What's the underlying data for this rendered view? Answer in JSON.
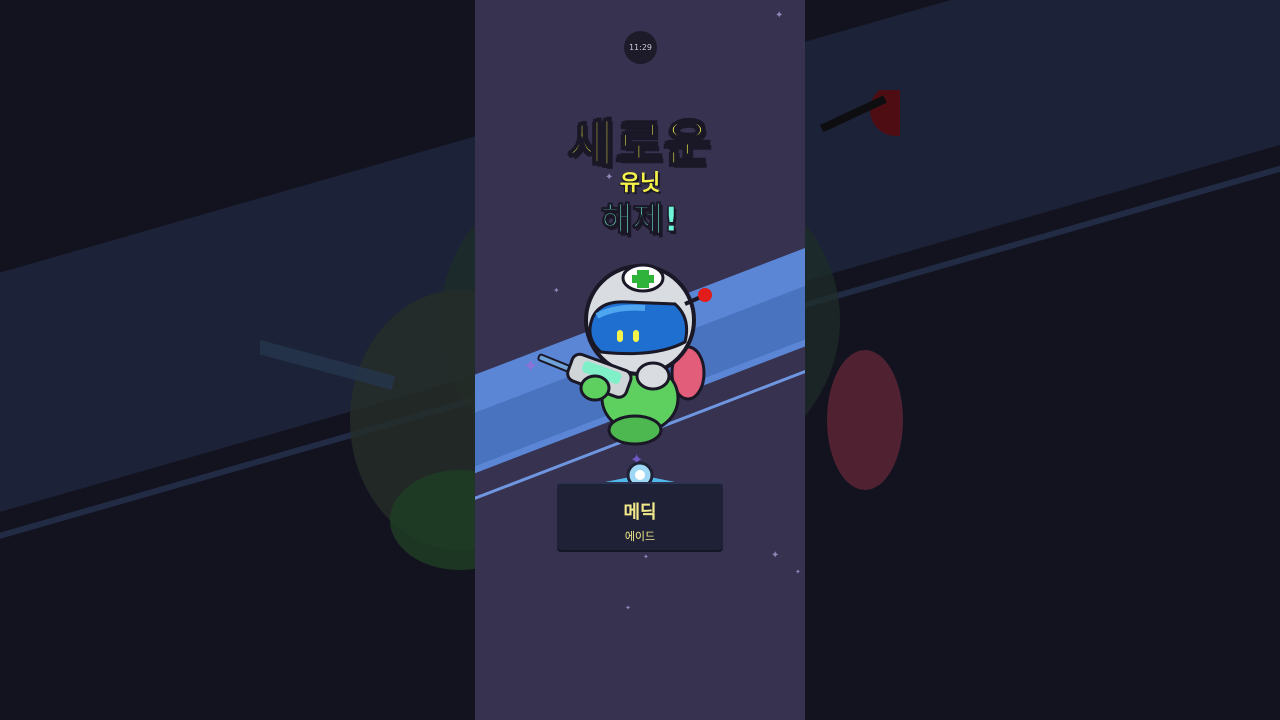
{
  "status": {
    "clock": "11:29"
  },
  "banner": {
    "line1": "새로운",
    "line2": "유닛",
    "line3": "해제!"
  },
  "unit": {
    "name": "메딕",
    "role": "에이드",
    "icon": "medic-robot-icon"
  },
  "colors": {
    "title_yellow": "#f5f24a",
    "title_cyan": "#6ef2d8",
    "screen_bg": "#363250",
    "stripe_blue": "#5b86d6",
    "card_bg": "#1f2236"
  }
}
